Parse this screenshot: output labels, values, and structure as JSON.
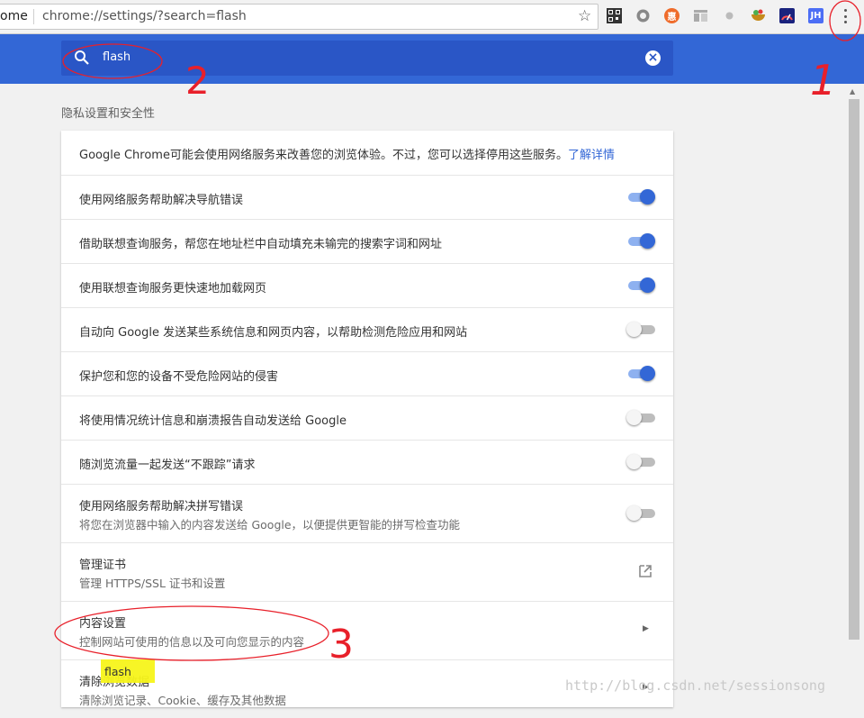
{
  "browser": {
    "url_prefix": "ome",
    "url_text": "chrome://settings/?search=flash",
    "ext_jh_label": "JH"
  },
  "search": {
    "value": "flash"
  },
  "section": {
    "title": "隐私设置和安全性"
  },
  "rows": [
    {
      "label": "Google Chrome可能会使用网络服务来改善您的浏览体验。不过，您可以选择停用这些服务。",
      "link": "了解详情"
    },
    {
      "label": "使用网络服务帮助解决导航错误",
      "toggle": "on"
    },
    {
      "label": "借助联想查询服务，帮您在地址栏中自动填充未输完的搜索字词和网址",
      "toggle": "on"
    },
    {
      "label": "使用联想查询服务更快速地加载网页",
      "toggle": "on"
    },
    {
      "label": "自动向 Google 发送某些系统信息和网页内容，以帮助检测危险应用和网站",
      "toggle": "off"
    },
    {
      "label": "保护您和您的设备不受危险网站的侵害",
      "toggle": "on"
    },
    {
      "label": "将使用情况统计信息和崩溃报告自动发送给 Google",
      "toggle": "off"
    },
    {
      "label": "随浏览流量一起发送“不跟踪”请求",
      "toggle": "off"
    },
    {
      "label": "使用网络服务帮助解决拼写错误",
      "sub": "将您在浏览器中输入的内容发送给 Google，以便提供更智能的拼写检查功能",
      "toggle": "off"
    },
    {
      "label": "管理证书",
      "sub": "管理 HTTPS/SSL 证书和设置"
    },
    {
      "label": "内容设置",
      "sub": "控制网站可使用的信息以及可向您显示的内容"
    },
    {
      "label": "清除浏览数据",
      "sub": "清除浏览记录、Cookie、缓存及其他数据"
    }
  ],
  "annotations": {
    "num1": "1",
    "num2": "2",
    "num3": "3",
    "highlight": "flash",
    "color": "#e8202a"
  },
  "watermark": "http://blog.csdn.net/sessionsong",
  "colors": {
    "header": "#3367d6",
    "toggle_on": "#3367d6"
  }
}
